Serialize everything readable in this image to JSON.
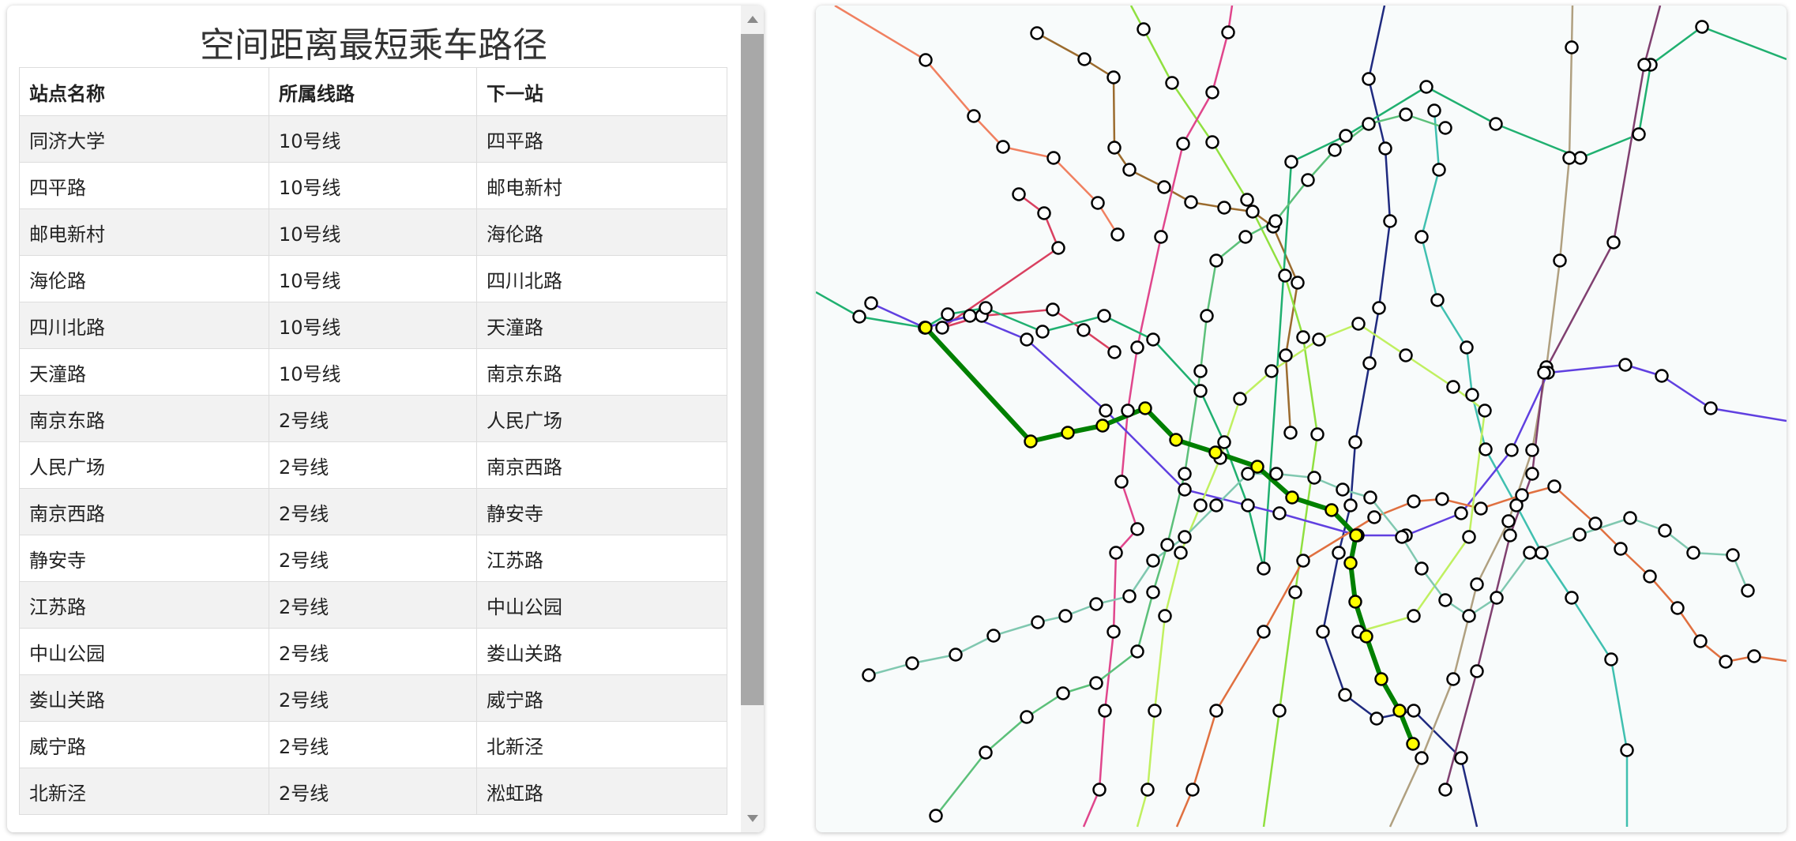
{
  "panel": {
    "title": "空间距离最短乘车路径",
    "headers": [
      "站点名称",
      "所属线路",
      "下一站"
    ],
    "rows": [
      [
        "同济大学",
        "10号线",
        "四平路"
      ],
      [
        "四平路",
        "10号线",
        "邮电新村"
      ],
      [
        "邮电新村",
        "10号线",
        "海伦路"
      ],
      [
        "海伦路",
        "10号线",
        "四川北路"
      ],
      [
        "四川北路",
        "10号线",
        "天潼路"
      ],
      [
        "天潼路",
        "10号线",
        "南京东路"
      ],
      [
        "南京东路",
        "2号线",
        "人民广场"
      ],
      [
        "人民广场",
        "2号线",
        "南京西路"
      ],
      [
        "南京西路",
        "2号线",
        "静安寺"
      ],
      [
        "静安寺",
        "2号线",
        "江苏路"
      ],
      [
        "江苏路",
        "2号线",
        "中山公园"
      ],
      [
        "中山公园",
        "2号线",
        "娄山关路"
      ],
      [
        "娄山关路",
        "2号线",
        "威宁路"
      ],
      [
        "威宁路",
        "2号线",
        "北新泾"
      ],
      [
        "北新泾",
        "2号线",
        "淞虹路"
      ]
    ]
  },
  "map": {
    "route_color": "#008000",
    "route_station_color": "#ffff00",
    "station_color": "#ffffff"
  }
}
